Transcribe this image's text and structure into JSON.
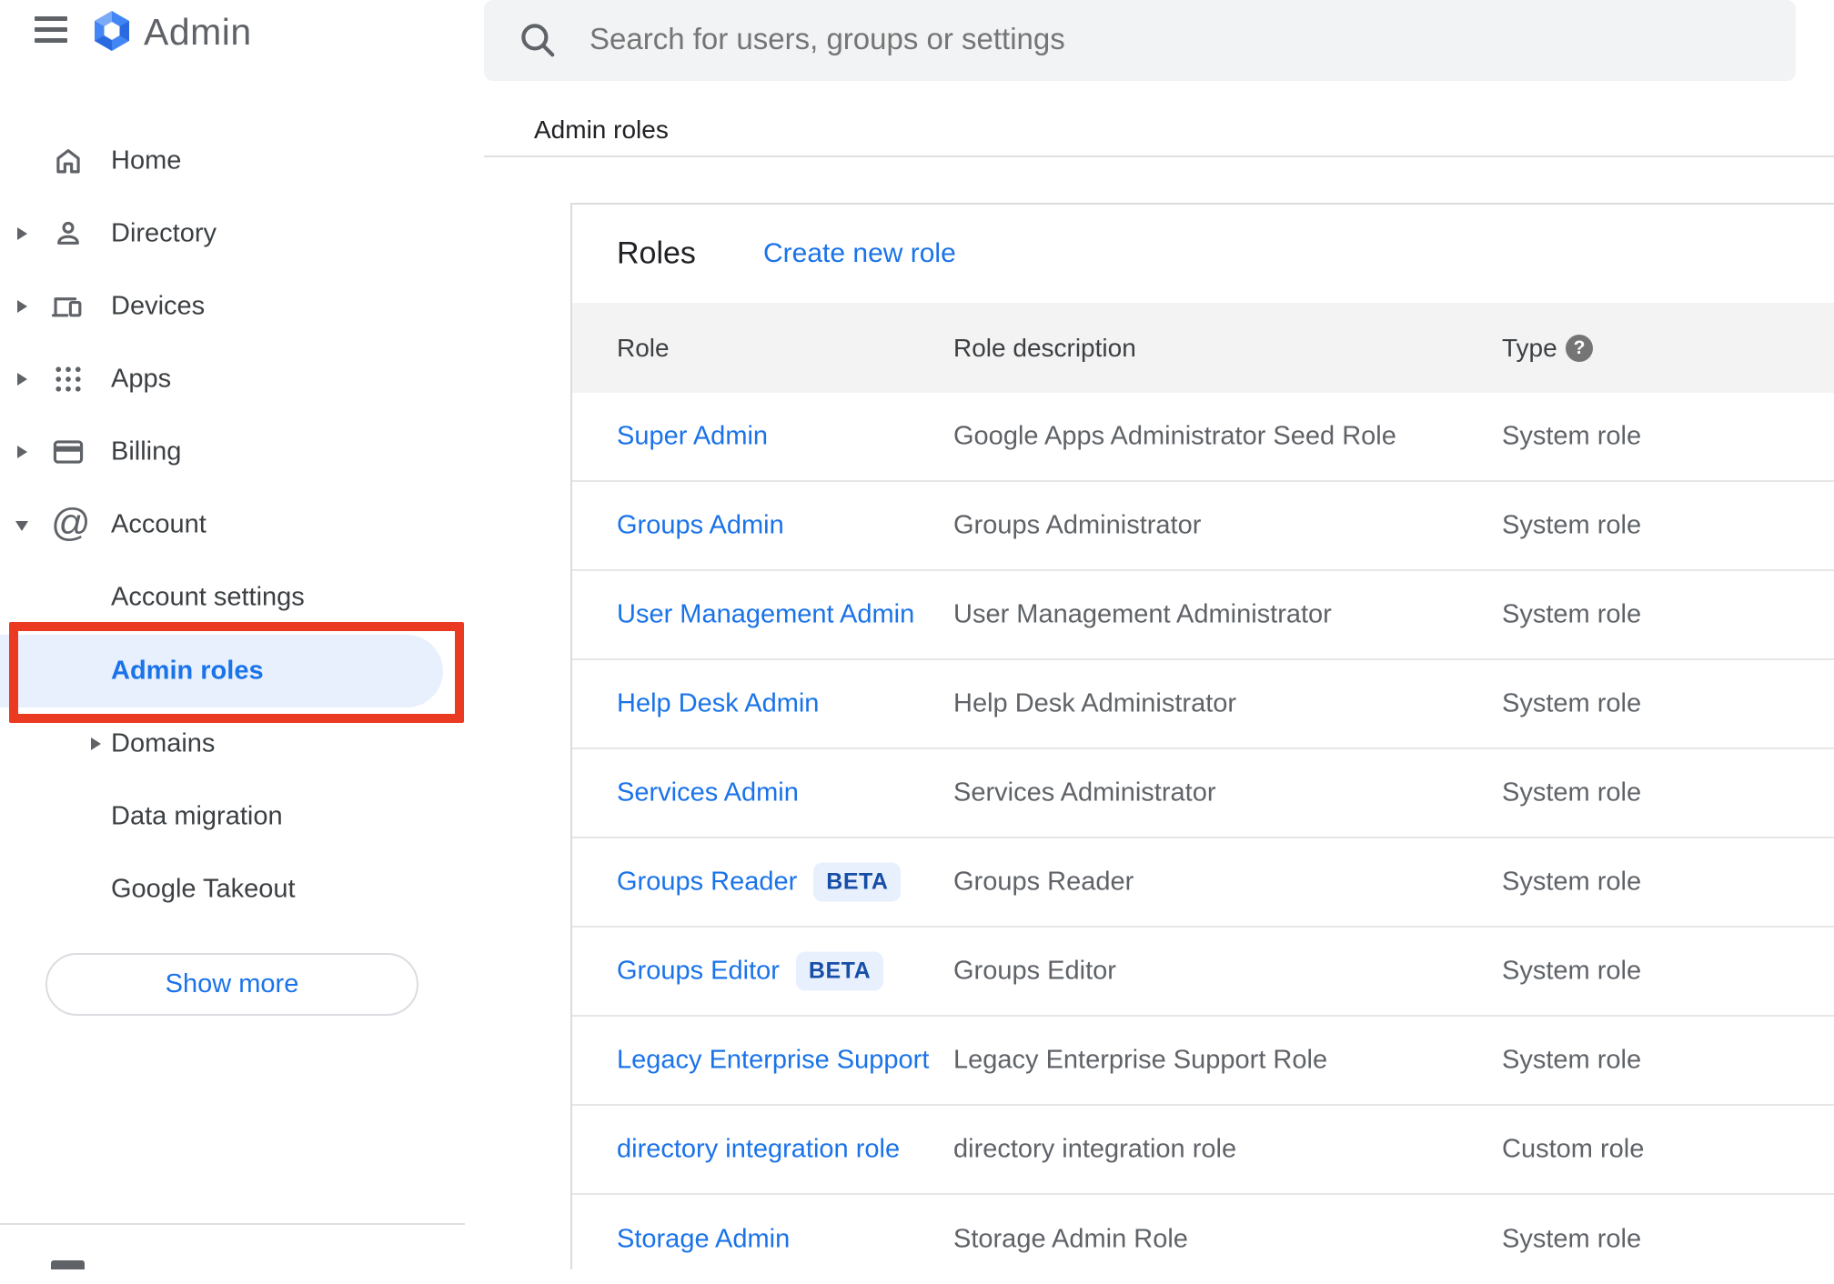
{
  "app": {
    "name": "Admin"
  },
  "search": {
    "placeholder": "Search for users, groups or settings"
  },
  "breadcrumb": "Admin roles",
  "sidebar": {
    "items": [
      {
        "label": "Home"
      },
      {
        "label": "Directory"
      },
      {
        "label": "Devices"
      },
      {
        "label": "Apps"
      },
      {
        "label": "Billing"
      },
      {
        "label": "Account"
      },
      {
        "label": "Account settings"
      },
      {
        "label": "Admin roles"
      },
      {
        "label": "Domains"
      },
      {
        "label": "Data migration"
      },
      {
        "label": "Google Takeout"
      }
    ],
    "show_more_label": "Show more"
  },
  "main": {
    "title": "Roles",
    "create_link": "Create new role",
    "table": {
      "columns": [
        "Role",
        "Role description",
        "Type"
      ],
      "rows": [
        {
          "role": "Super Admin",
          "description": "Google Apps Administrator Seed Role",
          "type": "System role"
        },
        {
          "role": "Groups Admin",
          "description": "Groups Administrator",
          "type": "System role"
        },
        {
          "role": "User Management Admin",
          "description": "User Management Administrator",
          "type": "System role"
        },
        {
          "role": "Help Desk Admin",
          "description": "Help Desk Administrator",
          "type": "System role"
        },
        {
          "role": "Services Admin",
          "description": "Services Administrator",
          "type": "System role"
        },
        {
          "role": "Groups Reader",
          "badge": "BETA",
          "description": "Groups Reader",
          "type": "System role"
        },
        {
          "role": "Groups Editor",
          "badge": "BETA",
          "description": "Groups Editor",
          "type": "System role"
        },
        {
          "role": "Legacy Enterprise Support",
          "description": "Legacy Enterprise Support Role",
          "type": "System role"
        },
        {
          "role": "directory integration role",
          "description": "directory integration role",
          "type": "Custom role"
        },
        {
          "role": "Storage Admin",
          "description": "Storage Admin Role",
          "type": "System role"
        }
      ]
    }
  },
  "colors": {
    "accent_blue": "#1a73e8",
    "active_item_bg": "#e8f0fe",
    "annotation_red": "#ea3a21",
    "table_header_bg": "#f3f3f4",
    "beta_badge_bg": "#e8f0fe",
    "beta_badge_text": "#174ea6"
  }
}
